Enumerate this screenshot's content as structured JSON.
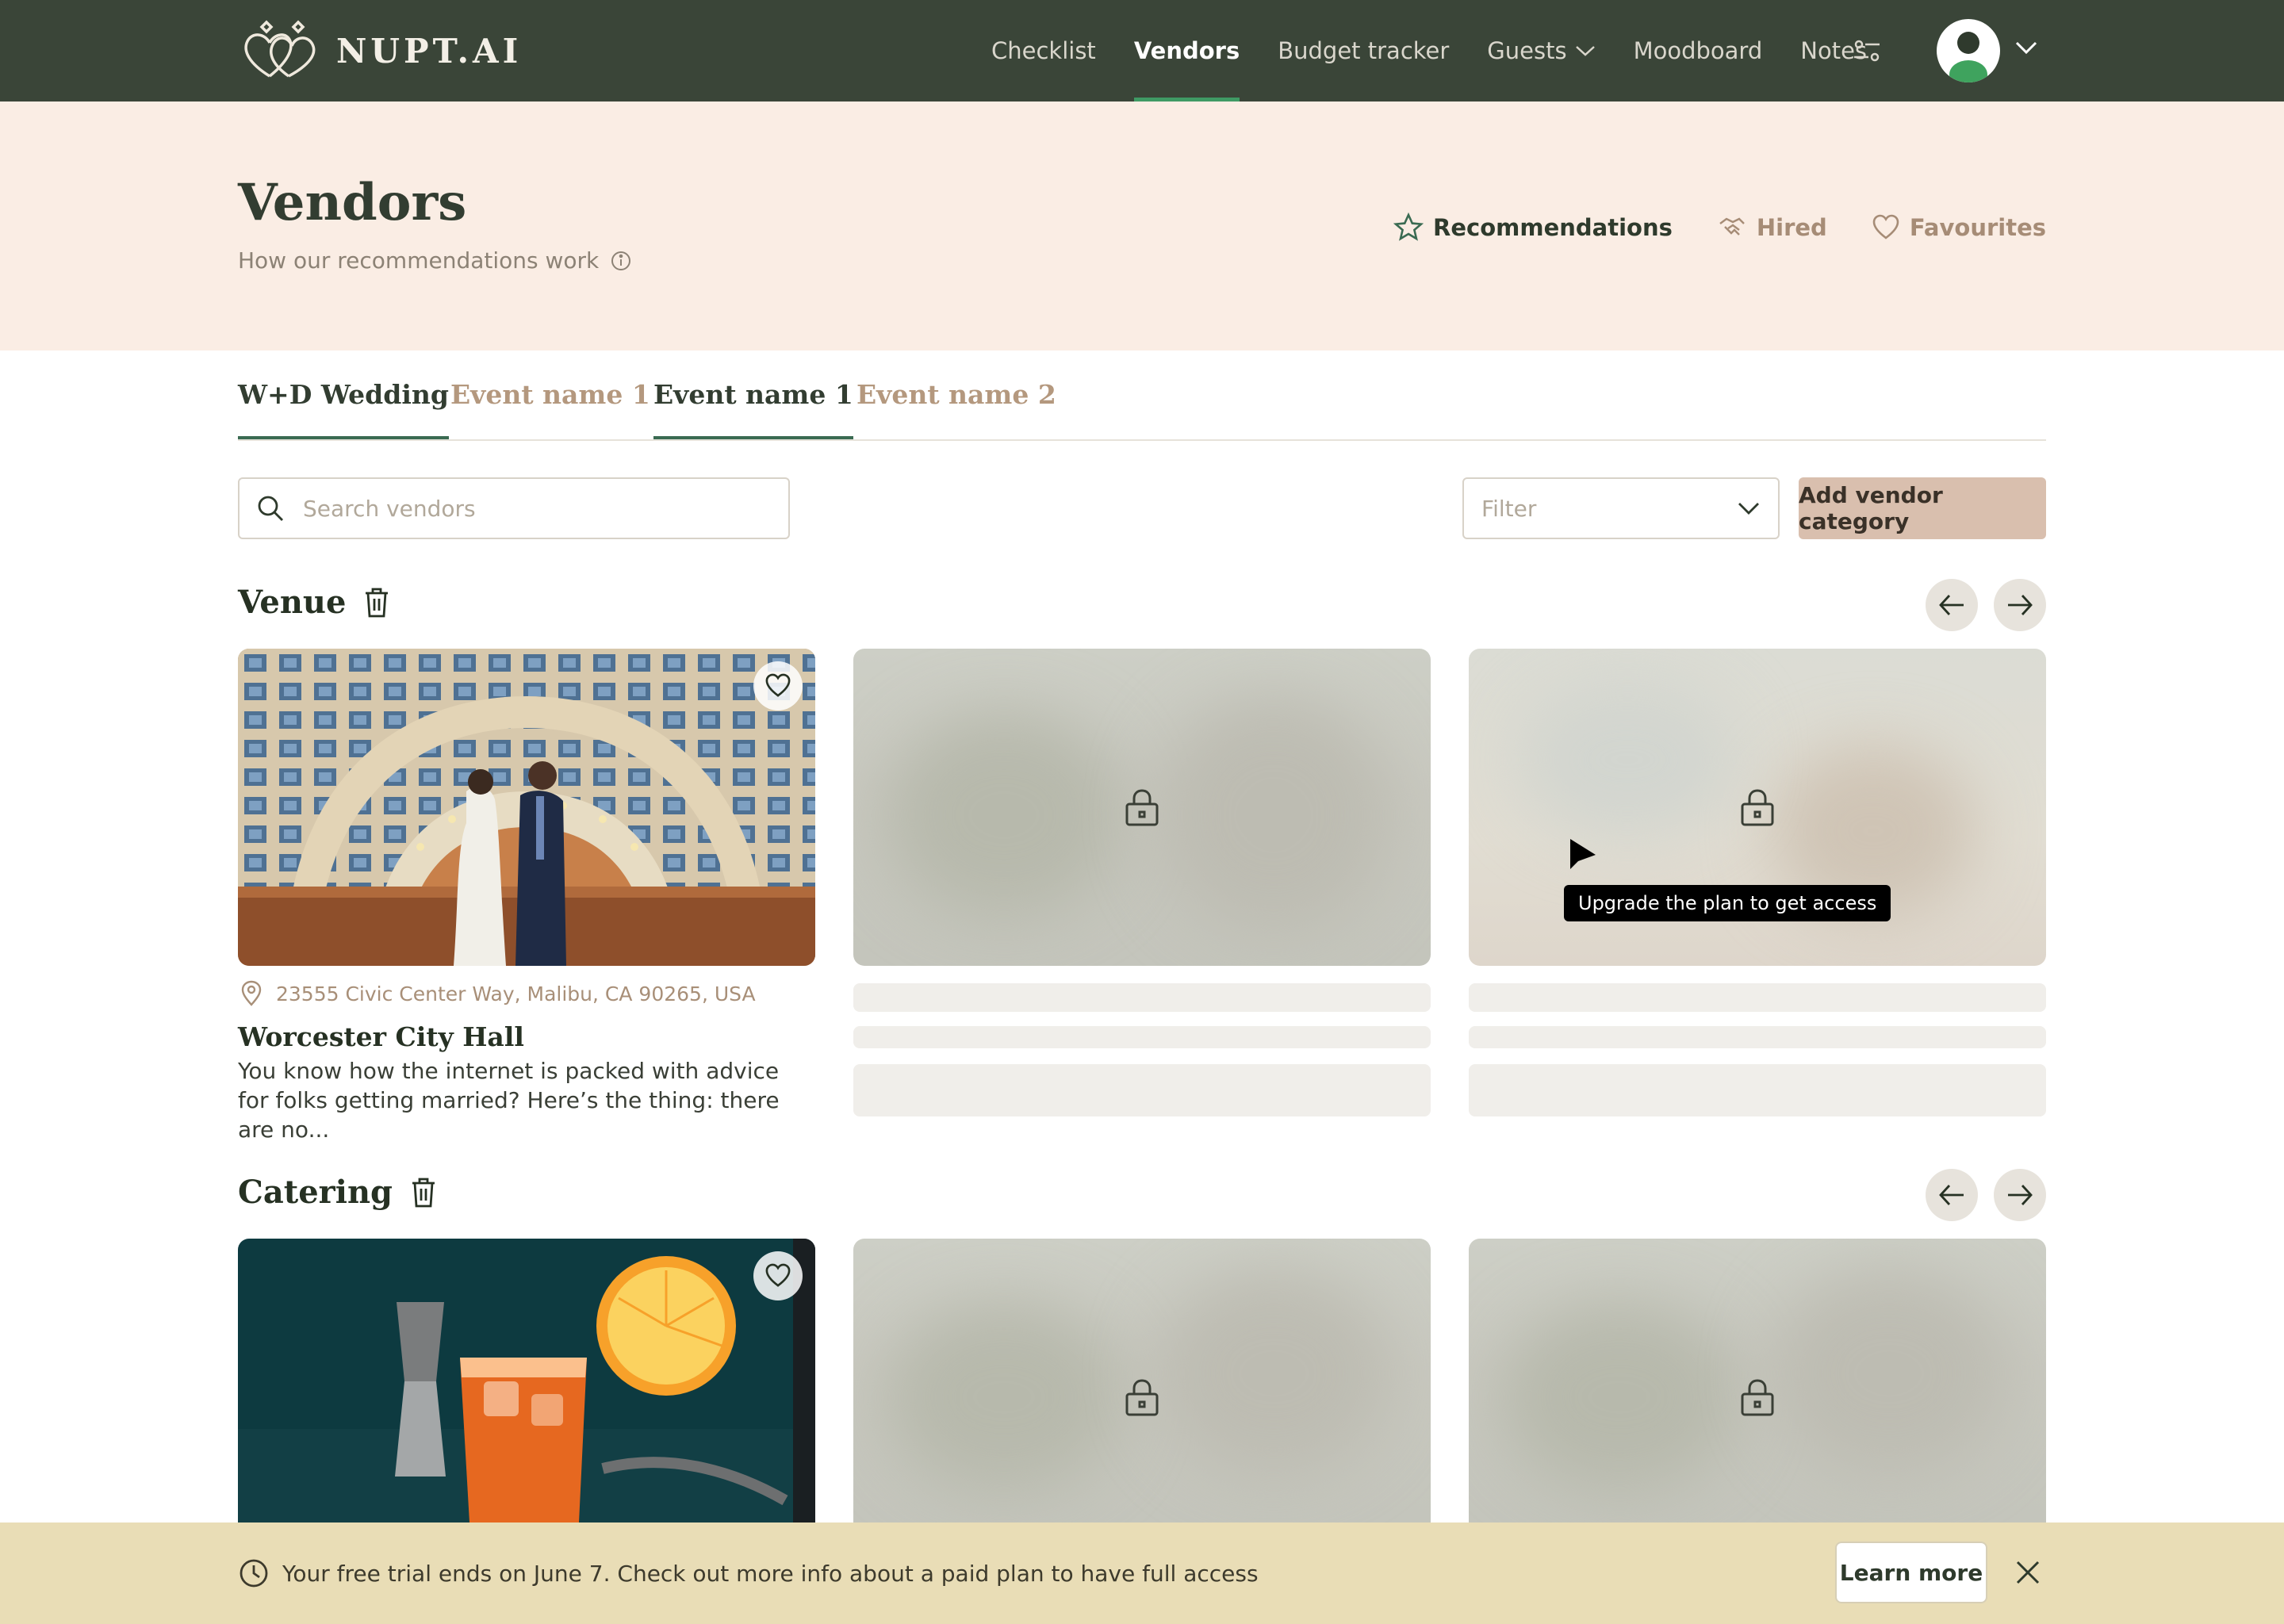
{
  "app": {
    "name": "NUPT.AI"
  },
  "nav": {
    "items": [
      {
        "label": "Checklist",
        "active": false
      },
      {
        "label": "Vendors",
        "active": true
      },
      {
        "label": "Budget tracker",
        "active": false
      },
      {
        "label": "Guests",
        "active": false,
        "has_dropdown": true
      },
      {
        "label": "Moodboard",
        "active": false
      },
      {
        "label": "Notes",
        "active": false
      }
    ],
    "tool_icon": "sliders-icon",
    "avatar_icon": "user-avatar-icon"
  },
  "page": {
    "title": "Vendors",
    "subtitle": "How our recommendations work",
    "links": [
      {
        "label": "Recommendations",
        "icon": "star-icon",
        "active": true
      },
      {
        "label": "Hired",
        "icon": "handshake-icon",
        "active": false
      },
      {
        "label": "Favourites",
        "icon": "heart-icon",
        "active": false
      }
    ]
  },
  "tabs": [
    {
      "label": "W+D Wedding",
      "selected": true
    },
    {
      "label": "Event name 1",
      "selected": false
    },
    {
      "label": "Event name 1",
      "selected": true
    },
    {
      "label": "Event name 2",
      "selected": false
    }
  ],
  "search": {
    "placeholder": "Search vendors",
    "value": ""
  },
  "filter": {
    "placeholder": "Filter"
  },
  "add_category_label": "Add vendor category",
  "sections": [
    {
      "title": "Venue",
      "vendor": {
        "address": "23555 Civic Center Way, Malibu, CA 90265, USA",
        "name": "Worcester City Hall",
        "description": "You know how the internet is packed with advice for folks getting married? Here’s the thing: there are no..."
      }
    },
    {
      "title": "Catering"
    }
  ],
  "tooltip": "Upgrade the plan to get access",
  "banner": {
    "text": "Your free trial ends on June 7. Check out more info about a paid plan to have full access",
    "button": "Learn more"
  },
  "colors": {
    "header_bg": "#3a4538",
    "hero_bg": "#faede4",
    "accent_green": "#3f9a64",
    "button_tan": "#d9bfae",
    "banner_bg": "#e9ddb6"
  }
}
